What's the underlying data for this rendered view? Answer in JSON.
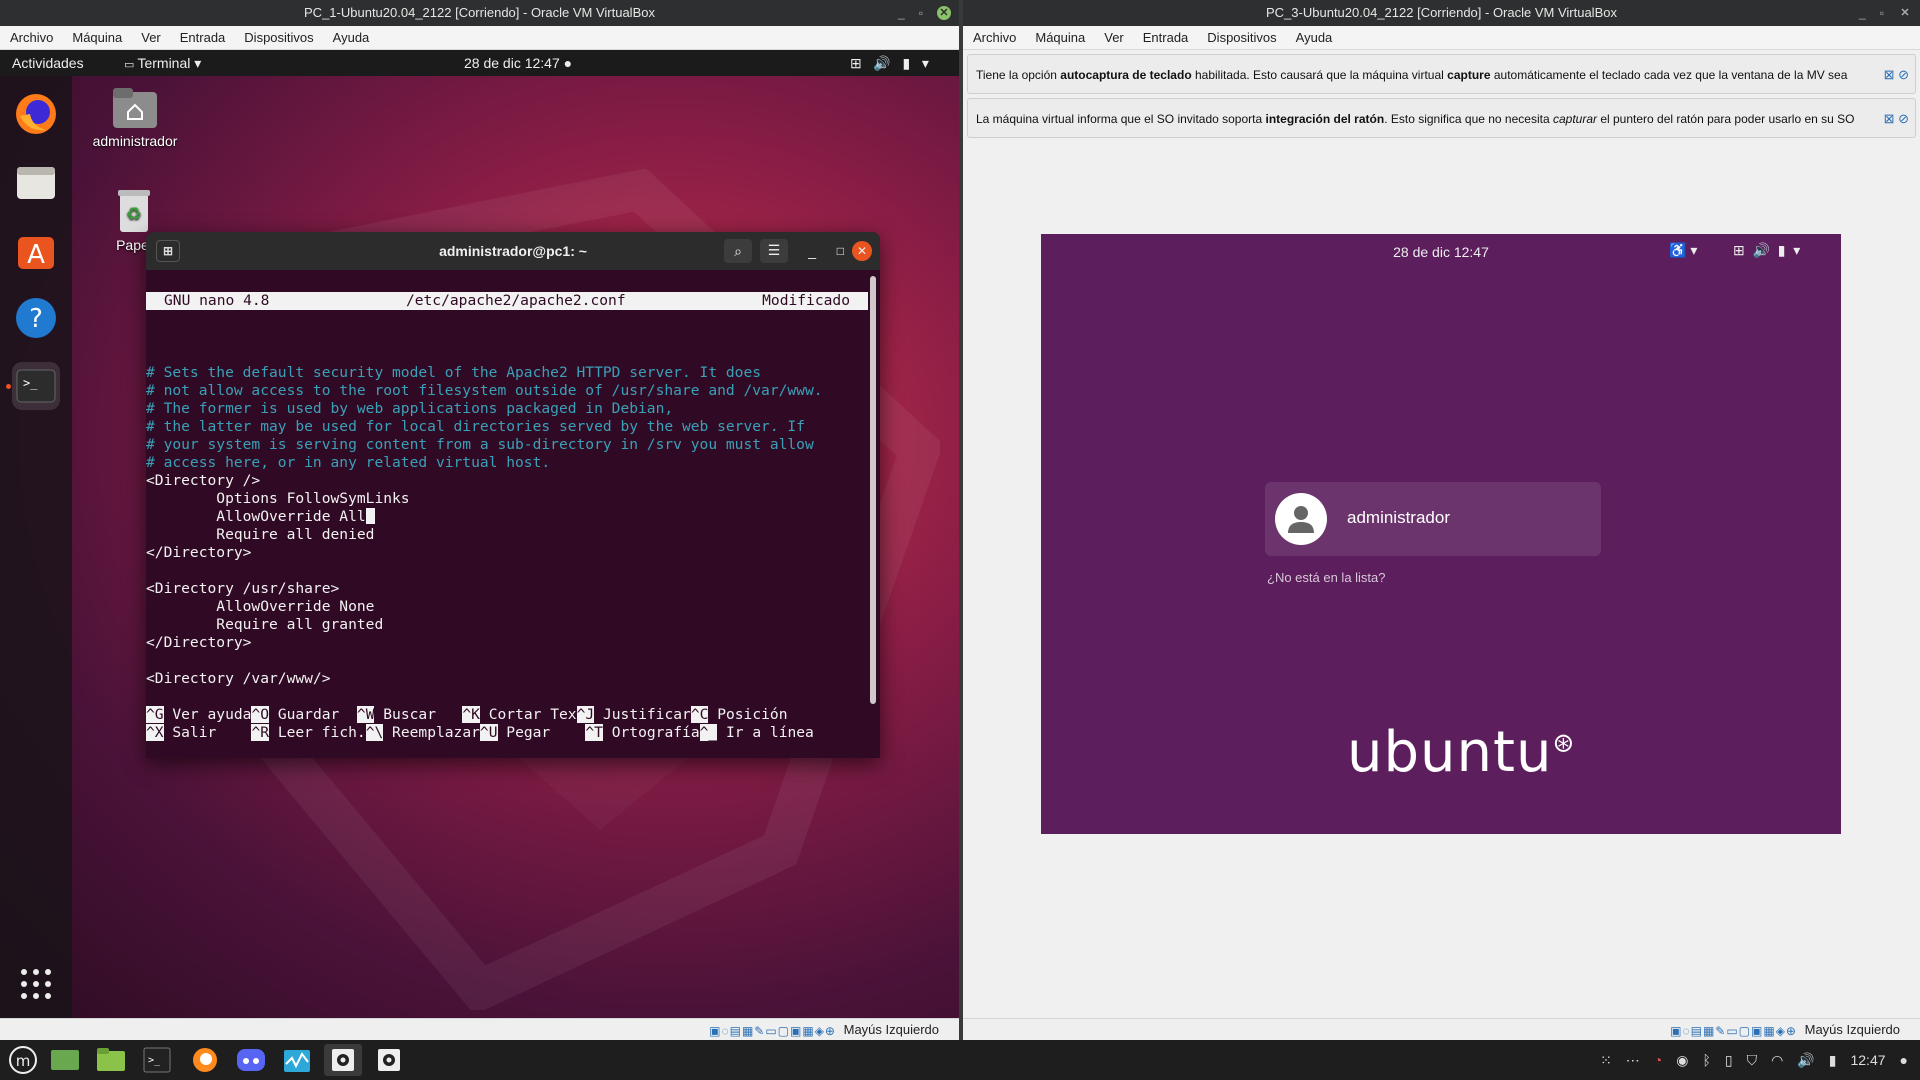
{
  "left_vm": {
    "title": "PC_1-Ubuntu20.04_2122 [Corriendo] - Oracle VM VirtualBox",
    "menu": [
      "Archivo",
      "Máquina",
      "Ver",
      "Entrada",
      "Dispositivos",
      "Ayuda"
    ],
    "status_text": "Mayús Izquierdo",
    "guest": {
      "activities": "Actividades",
      "app_menu": "Terminal",
      "datetime": "28 de dic  12:47",
      "desktop_icons": [
        "administrador",
        "Papel"
      ],
      "dock_icons": [
        "firefox-icon",
        "files-icon",
        "software-icon",
        "help-icon",
        "terminal-icon",
        "show-apps-icon"
      ],
      "terminal": {
        "title": "administrador@pc1: ~",
        "nano_version": "GNU nano 4.8",
        "file": "/etc/apache2/apache2.conf",
        "state": "Modificado",
        "comment_lines": [
          "# Sets the default security model of the Apache2 HTTPD server. It does",
          "# not allow access to the root filesystem outside of /usr/share and /var/www.",
          "# The former is used by web applications packaged in Debian,",
          "# the latter may be used for local directories served by the web server. If",
          "# your system is serving content from a sub-directory in /srv you must allow",
          "# access here, or in any related virtual host."
        ],
        "code_lines": [
          "<Directory />",
          "        Options FollowSymLinks",
          "        AllowOverride All",
          "        Require all denied",
          "</Directory>",
          "",
          "<Directory /usr/share>",
          "        AllowOverride None",
          "        Require all granted",
          "</Directory>",
          "",
          "<Directory /var/www/>"
        ],
        "shortcuts_row1": [
          {
            "key": "^G",
            "label": " Ver ayuda"
          },
          {
            "key": "^O",
            "label": " Guardar  "
          },
          {
            "key": "^W",
            "label": " Buscar   "
          },
          {
            "key": "^K",
            "label": " Cortar Tex"
          },
          {
            "key": "^J",
            "label": " Justificar"
          },
          {
            "key": "^C",
            "label": " Posición"
          }
        ],
        "shortcuts_row2": [
          {
            "key": "^X",
            "label": " Salir    "
          },
          {
            "key": "^R",
            "label": " Leer fich."
          },
          {
            "key": "^\\",
            "label": " Reemplazar"
          },
          {
            "key": "^U",
            "label": " Pegar    "
          },
          {
            "key": "^T",
            "label": " Ortografía"
          },
          {
            "key": "^_",
            "label": " Ir a línea"
          }
        ]
      }
    }
  },
  "right_vm": {
    "title": "PC_3-Ubuntu20.04_2122 [Corriendo] - Oracle VM VirtualBox",
    "menu": [
      "Archivo",
      "Máquina",
      "Ver",
      "Entrada",
      "Dispositivos",
      "Ayuda"
    ],
    "status_text": "Mayús Izquierdo",
    "notice1": {
      "a": "Tiene la opción ",
      "b": "autocaptura de teclado",
      "c": " habilitada. Esto causará que la máquina virtual ",
      "d": "capture",
      "e": " automáticamente el teclado cada vez que la ventana de la MV sea"
    },
    "notice2": {
      "a": "La máquina virtual informa que el SO invitado soporta ",
      "b": "integración del ratón",
      "c": ". Esto significa que no necesita ",
      "d": "capturar",
      "e": " el puntero del ratón para poder usarlo en su SO"
    },
    "guest": {
      "datetime": "28 de dic  12:47",
      "user": "administrador",
      "not_listed": "¿No está en la lista?",
      "logo": "ubuntu"
    }
  },
  "taskbar": {
    "clock": "12:47",
    "apps": [
      "mint-menu-icon",
      "show-desktop-icon",
      "files-icon",
      "terminal-icon",
      "firefox-icon",
      "discord-icon",
      "monitor-icon",
      "virtualbox-icon",
      "virtualbox-icon-2"
    ]
  }
}
